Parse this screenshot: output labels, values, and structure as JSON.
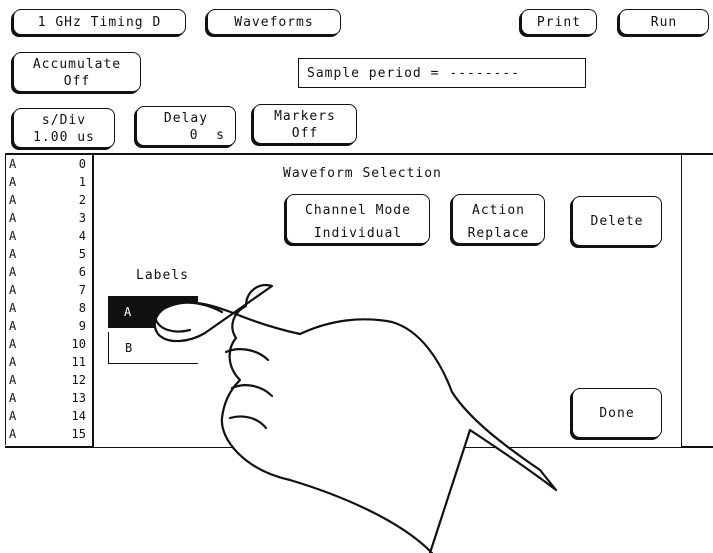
{
  "top": {
    "module": "1 GHz Timing D",
    "menu": "Waveforms",
    "print": "Print",
    "run": "Run"
  },
  "accumulate": {
    "line1": "Accumulate",
    "line2": "Off"
  },
  "sample_period": {
    "label": "Sample period =",
    "value": "--------"
  },
  "sdiv": {
    "line1": "s/Div",
    "line2": "1.00 us"
  },
  "delay": {
    "line1": "Delay",
    "line2": "0  s"
  },
  "markers": {
    "line1": "Markers",
    "line2": "Off"
  },
  "labels_list": [
    {
      "label": "A",
      "num": "0"
    },
    {
      "label": "A",
      "num": "1"
    },
    {
      "label": "A",
      "num": "2"
    },
    {
      "label": "A",
      "num": "3"
    },
    {
      "label": "A",
      "num": "4"
    },
    {
      "label": "A",
      "num": "5"
    },
    {
      "label": "A",
      "num": "6"
    },
    {
      "label": "A",
      "num": "7"
    },
    {
      "label": "A",
      "num": "8"
    },
    {
      "label": "A",
      "num": "9"
    },
    {
      "label": "A",
      "num": "10"
    },
    {
      "label": "A",
      "num": "11"
    },
    {
      "label": "A",
      "num": "12"
    },
    {
      "label": "A",
      "num": "13"
    },
    {
      "label": "A",
      "num": "14"
    },
    {
      "label": "A",
      "num": "15"
    }
  ],
  "dialog": {
    "title": "Waveform Selection",
    "channel_mode": {
      "line1": "Channel Mode",
      "line2": "Individual"
    },
    "action": {
      "line1": "Action",
      "line2": "Replace"
    },
    "delete": "Delete",
    "labels_title": "Labels",
    "label_options": [
      "A",
      "B"
    ],
    "selected": "A",
    "done": "Done"
  }
}
